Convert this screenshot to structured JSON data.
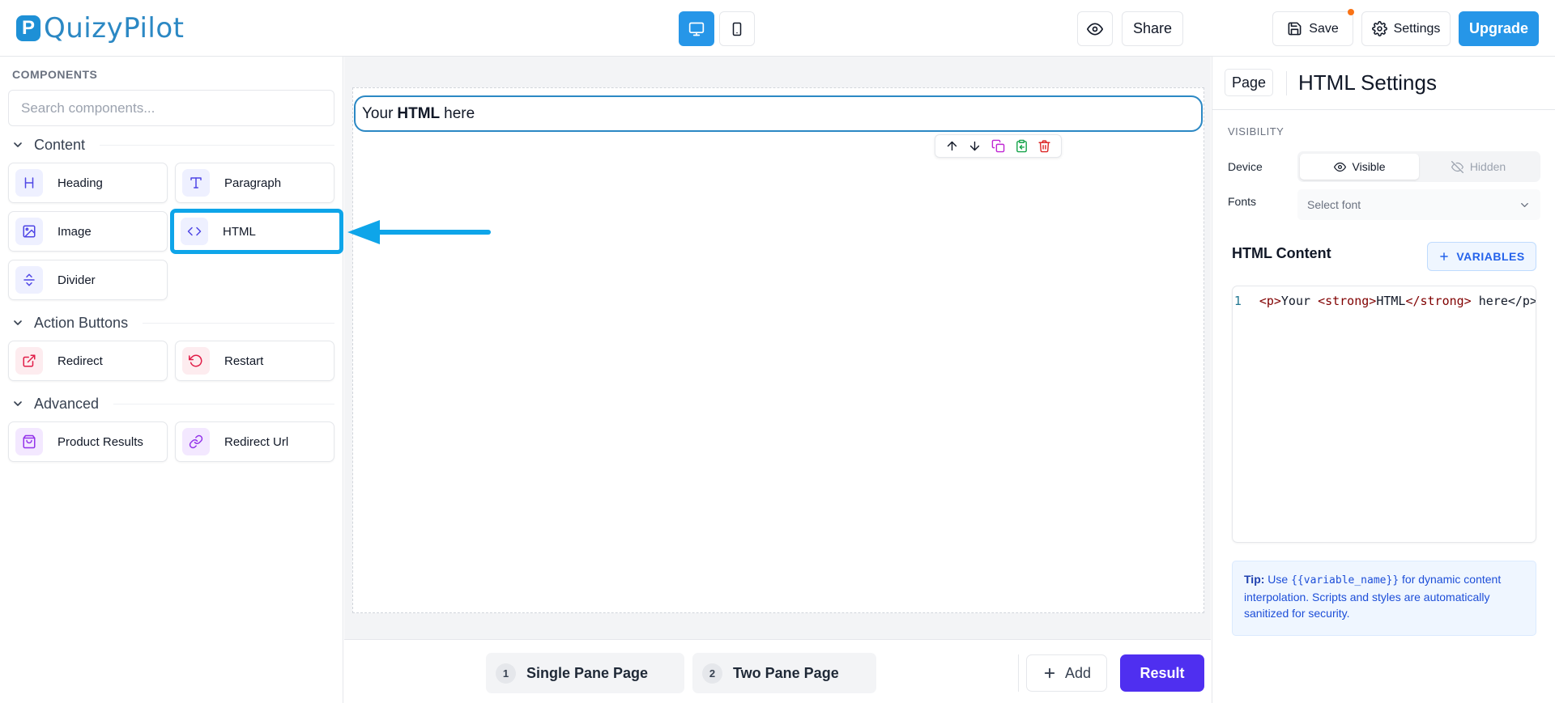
{
  "app": {
    "logo_letter": "P",
    "name": "QuizyPilot"
  },
  "topbar": {
    "share_label": "Share",
    "save_label": "Save",
    "settings_label": "Settings",
    "upgrade_label": "Upgrade"
  },
  "sidebar": {
    "title": "COMPONENTS",
    "search_placeholder": "Search components...",
    "sections": {
      "content": {
        "label": "Content",
        "items": {
          "heading": "Heading",
          "paragraph": "Paragraph",
          "image": "Image",
          "html": "HTML",
          "divider": "Divider"
        }
      },
      "action_buttons": {
        "label": "Action Buttons",
        "items": {
          "redirect": "Redirect",
          "restart": "Restart"
        }
      },
      "advanced": {
        "label": "Advanced",
        "items": {
          "product_results": "Product Results",
          "redirect_url": "Redirect Url"
        }
      }
    }
  },
  "canvas": {
    "html_block": {
      "before": "Your",
      "bold": "HTML",
      "after": "here"
    }
  },
  "bottombar": {
    "pages": [
      {
        "num": "1",
        "label": "Single Pane Page"
      },
      {
        "num": "2",
        "label": "Two Pane Page"
      }
    ],
    "add_label": "Add",
    "result_label": "Result"
  },
  "right_panel": {
    "page_button": "Page",
    "title": "HTML Settings",
    "visibility_title": "VISIBILITY",
    "device_label": "Device",
    "visible_label": "Visible",
    "hidden_label": "Hidden",
    "fonts_label": "Fonts",
    "font_placeholder": "Select font",
    "content_title": "HTML Content",
    "variables_label": "VARIABLES",
    "code": {
      "line_number": "1",
      "tag_open_p": "<p>",
      "text_your": "Your ",
      "tag_open_strong": "<strong>",
      "text_html": "HTML",
      "tag_close_strong": "</strong>",
      "text_rest": " here</p>"
    },
    "tip": {
      "label": "Tip:",
      "before": "Use",
      "code": "{{variable_name}}",
      "after": "for dynamic content interpolation. Scripts and styles are automatically sanitized for security."
    }
  },
  "colors": {
    "brand_blue": "#2696e8",
    "primary_purple": "#4f2ff0",
    "annotation_cyan": "#0ea5e9",
    "danger_red": "#dc2626",
    "success_green": "#16a34a",
    "magenta": "#c026d3"
  }
}
